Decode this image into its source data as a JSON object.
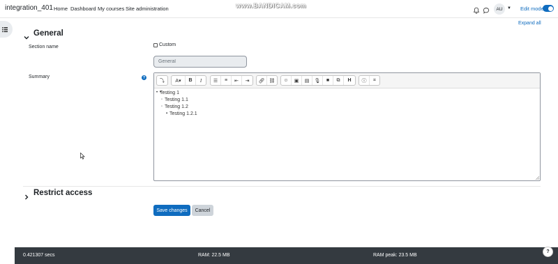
{
  "app": {
    "site_name": "integration_401",
    "watermark": "www.BANDICAM.com"
  },
  "nav": {
    "links": [
      "Home",
      "Dashboard",
      "My courses",
      "Site administration"
    ],
    "user_initials": "AU",
    "edit_mode_label": "Edit mode",
    "edit_mode_on": true
  },
  "page": {
    "expand_all": "Expand all",
    "section_general": "General",
    "section_restrict": "Restrict access",
    "section_name_label": "Section name",
    "custom_label": "Custom",
    "section_name_value": "General",
    "summary_label": "Summary"
  },
  "editor": {
    "list_items": [
      {
        "text": "Testing 1",
        "level": 1
      },
      {
        "text": "Testing 1.1",
        "level": 2
      },
      {
        "text": "Testing 1.2",
        "level": 2
      },
      {
        "text": "Testing 1.2.1",
        "level": 3
      }
    ]
  },
  "buttons": {
    "save": "Save changes",
    "cancel": "Cancel"
  },
  "footer": {
    "time": "0.421307 secs",
    "ram": "RAM: 22.5 MB",
    "ram_peak": "RAM peak: 23.5 MB",
    "help": "?"
  },
  "colors": {
    "accent": "#0f6cbf",
    "footer_bg": "#343a40"
  }
}
